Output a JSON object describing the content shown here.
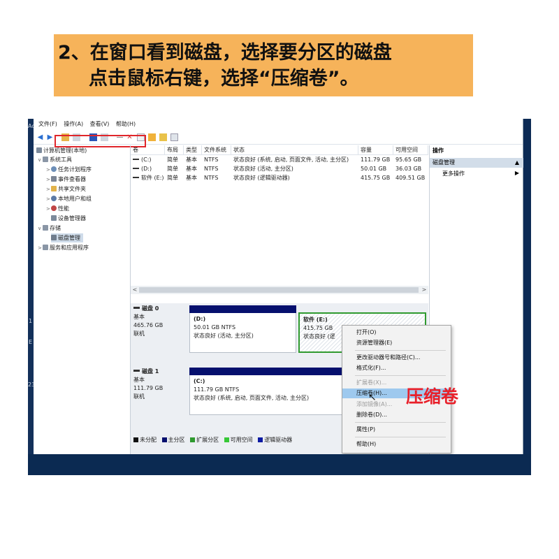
{
  "banner": {
    "line1": "2、在窗口看到磁盘，选择要分区的磁盘",
    "line2": "点击鼠标右键，选择“压缩卷”。"
  },
  "desktop": {
    "frag1": "Ac",
    "frag2": "1",
    "frag3": "E",
    "frag4": "23"
  },
  "menubar": {
    "file": "文件(F)",
    "action": "操作(A)",
    "view": "查看(V)",
    "help": "帮助(H)"
  },
  "tree": {
    "root": "计算机管理(本地)",
    "system_tools": "系统工具",
    "task_scheduler": "任务计划程序",
    "event_viewer": "事件查看器",
    "shared_folders": "共享文件夹",
    "local_users": "本地用户和组",
    "performance": "性能",
    "device_manager": "设备管理器",
    "storage": "存储",
    "disk_management": "磁盘管理",
    "services_apps": "服务和应用程序"
  },
  "volumes": {
    "columns": [
      "卷",
      "布局",
      "类型",
      "文件系统",
      "状态",
      "容量",
      "可用空间"
    ],
    "rows": [
      [
        "(C:)",
        "简单",
        "基本",
        "NTFS",
        "状态良好 (系统, 启动, 页面文件, 活动, 主分区)",
        "111.79 GB",
        "95.65 GB"
      ],
      [
        "(D:)",
        "简单",
        "基本",
        "NTFS",
        "状态良好 (活动, 主分区)",
        "50.01 GB",
        "36.03 GB"
      ],
      [
        "软件 (E:)",
        "简单",
        "基本",
        "NTFS",
        "状态良好 (逻辑驱动器)",
        "415.75 GB",
        "409.51 GB"
      ]
    ]
  },
  "disks": {
    "disk0": {
      "name": "磁盘 0",
      "type": "基本",
      "size": "465.76 GB",
      "status": "联机"
    },
    "disk1": {
      "name": "磁盘 1",
      "type": "基本",
      "size": "111.79 GB",
      "status": "联机"
    },
    "part_d": {
      "name": "(D:)",
      "size": "50.01 GB NTFS",
      "status": "状态良好 (活动, 主分区)"
    },
    "part_e": {
      "name": "软件  (E:)",
      "size": "415.75 GB",
      "status": "状态良好 (逻"
    },
    "part_c": {
      "name": "(C:)",
      "size": "111.79 GB NTFS",
      "status": "状态良好 (系统, 启动, 页面文件, 活动, 主分区)"
    }
  },
  "legend": {
    "unallocated": "未分配",
    "primary": "主分区",
    "extended": "扩展分区",
    "free": "可用空间",
    "logical": "逻辑驱动器"
  },
  "legend_colors": {
    "unallocated": "#111111",
    "primary": "#06106e",
    "extended": "#2f9a2f",
    "free": "#37c837",
    "logical": "#0b1aa3"
  },
  "actions": {
    "title": "操作",
    "section": "磁盘管理",
    "more": "更多操作"
  },
  "context_menu": {
    "open": "打开(O)",
    "explore": "资源管理器(E)",
    "change_letter": "更改驱动器号和路径(C)...",
    "format": "格式化(F)...",
    "extend": "扩展卷(X)...",
    "shrink": "压缩卷(H)...",
    "mirror": "添加镜像(A)...",
    "delete": "删除卷(D)...",
    "properties": "属性(P)",
    "help": "帮助(H)"
  },
  "callout": "压缩卷"
}
